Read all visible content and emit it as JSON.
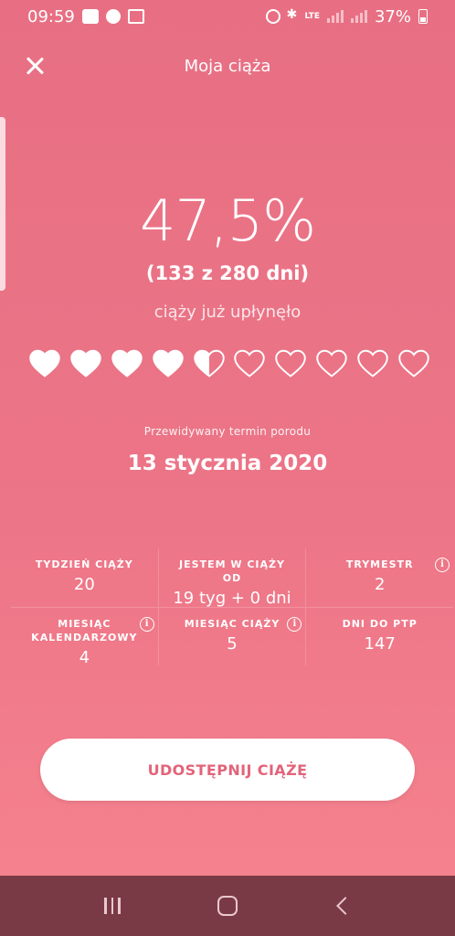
{
  "status_bar": {
    "time": "09:59",
    "network": "LTE",
    "battery": "37%"
  },
  "header": {
    "title": "Moja ciąża"
  },
  "progress": {
    "percent": "47,5%",
    "days": "(133 z 280 dni)",
    "caption": "ciąży już upłynęło",
    "hearts_total": 10,
    "hearts_filled": 4.5
  },
  "due": {
    "label": "Przewidywany termin porodu",
    "date": "13 stycznia 2020"
  },
  "stats": {
    "week_label": "TYDZIEŃ CIĄŻY",
    "week_value": "20",
    "duration_label": "JESTEM W CIĄŻY OD",
    "duration_value": "19 tyg + 0 dni",
    "trimester_label": "TRYMESTR",
    "trimester_value": "2",
    "cal_month_label": "MIESIĄC KALENDARZOWY",
    "cal_month_value": "4",
    "preg_month_label": "MIESIĄC CIĄŻY",
    "preg_month_value": "5",
    "days_to_due_label": "DNI DO PTP",
    "days_to_due_value": "147"
  },
  "actions": {
    "share_label": "UDOSTĘPNIJ CIĄŻĘ"
  },
  "colors": {
    "background_top": "#e86f83",
    "background_bottom": "#f7838f",
    "accent_text": "#e26479",
    "navbar": "#7a3a45"
  }
}
